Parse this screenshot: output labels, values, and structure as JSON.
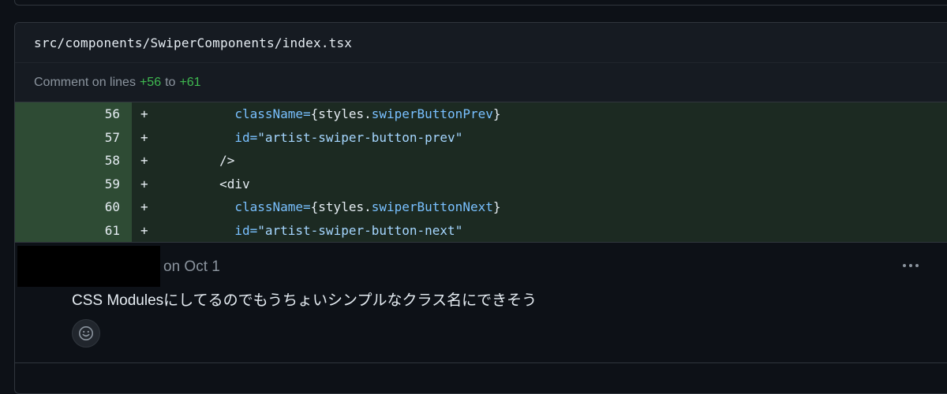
{
  "file": {
    "path": "src/components/SwiperComponents/index.tsx"
  },
  "comment_range": {
    "prefix": "Comment on lines",
    "start": "+56",
    "middle": "to",
    "end": "+61"
  },
  "diff_lines": [
    {
      "number": "56",
      "sign": "+",
      "indent": "          ",
      "parts": [
        {
          "t": "attr",
          "v": "className="
        },
        {
          "t": "text",
          "v": "{styles."
        },
        {
          "t": "attr",
          "v": "swiperButtonPrev"
        },
        {
          "t": "text",
          "v": "}"
        }
      ]
    },
    {
      "number": "57",
      "sign": "+",
      "indent": "          ",
      "parts": [
        {
          "t": "attr",
          "v": "id="
        },
        {
          "t": "str",
          "v": "\"artist-swiper-button-prev\""
        }
      ]
    },
    {
      "number": "58",
      "sign": "+",
      "indent": "        ",
      "parts": [
        {
          "t": "text",
          "v": "/>"
        }
      ]
    },
    {
      "number": "59",
      "sign": "+",
      "indent": "        ",
      "parts": [
        {
          "t": "text",
          "v": "<div"
        }
      ]
    },
    {
      "number": "60",
      "sign": "+",
      "indent": "          ",
      "parts": [
        {
          "t": "attr",
          "v": "className="
        },
        {
          "t": "text",
          "v": "{styles."
        },
        {
          "t": "attr",
          "v": "swiperButtonNext"
        },
        {
          "t": "text",
          "v": "}"
        }
      ]
    },
    {
      "number": "61",
      "sign": "+",
      "indent": "          ",
      "parts": [
        {
          "t": "attr",
          "v": "id="
        },
        {
          "t": "str",
          "v": "\"artist-swiper-button-next\""
        }
      ]
    }
  ],
  "comment": {
    "date": "on Oct 1",
    "body": "CSS Modulesにしてるのでもうちょいシンプルなクラス名にできそう"
  },
  "icons": {
    "more": "kebab-horizontal-icon",
    "reaction": "smiley-icon"
  },
  "colors": {
    "background": "#0d1117",
    "addition_number_bg": "#2e4b34",
    "addition_code_bg": "#1c2a22",
    "addition_text": "#3fb950",
    "attribute": "#79c0ff",
    "string": "#a5d6ff",
    "muted": "#8b949e"
  }
}
